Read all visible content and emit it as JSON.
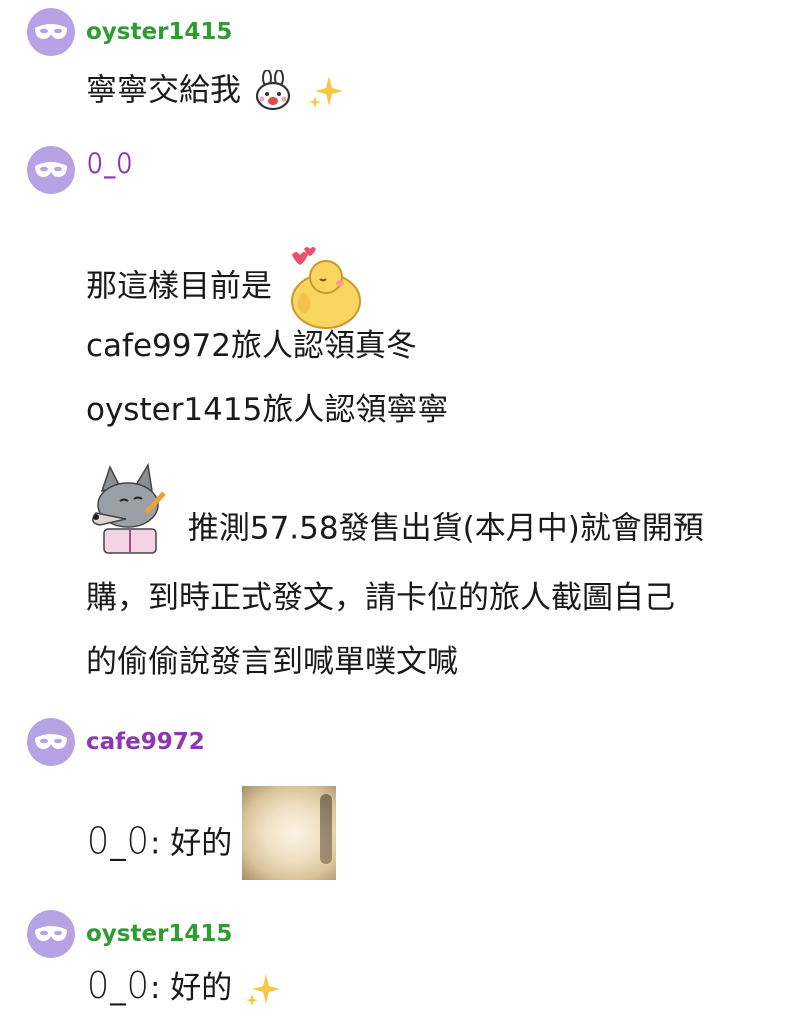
{
  "colors": {
    "username_green": "#2e9c31",
    "username_purple": "#8e36b0",
    "avatar_bg": "#b6a2e4",
    "text": "#1a1a1a"
  },
  "messages": [
    {
      "user": "oyster1415",
      "user_color": "#2e9c31",
      "lines": [
        "寧寧交給我"
      ],
      "stickers": [
        "bunny-sticker-icon",
        "sparkle-icon"
      ]
    },
    {
      "user": "ꄲ_ꄲ",
      "user_color": "#8e36b0",
      "lines": [
        "那這樣目前是",
        "cafe9972旅人認領真冬",
        "oyster1415旅人認領寧寧",
        "推測57.58發售出貨(本月中)就會開預",
        "購，到時正式發文，請卡位的旅人截圖自己",
        "的偷偷說發言到喊單噗文喊"
      ],
      "stickers": [
        "chick-sticker-icon",
        "wolf-sticker-icon"
      ]
    },
    {
      "user": "cafe9972",
      "user_color": "#8e36b0",
      "lines": [
        "ꄲ_ꄲ: 好的"
      ],
      "stickers": [
        "duck-photo"
      ]
    },
    {
      "user": "oyster1415",
      "user_color": "#2e9c31",
      "lines": [
        "ꄲ_ꄲ: 好的"
      ],
      "stickers": [
        "sparkle-icon"
      ]
    }
  ]
}
